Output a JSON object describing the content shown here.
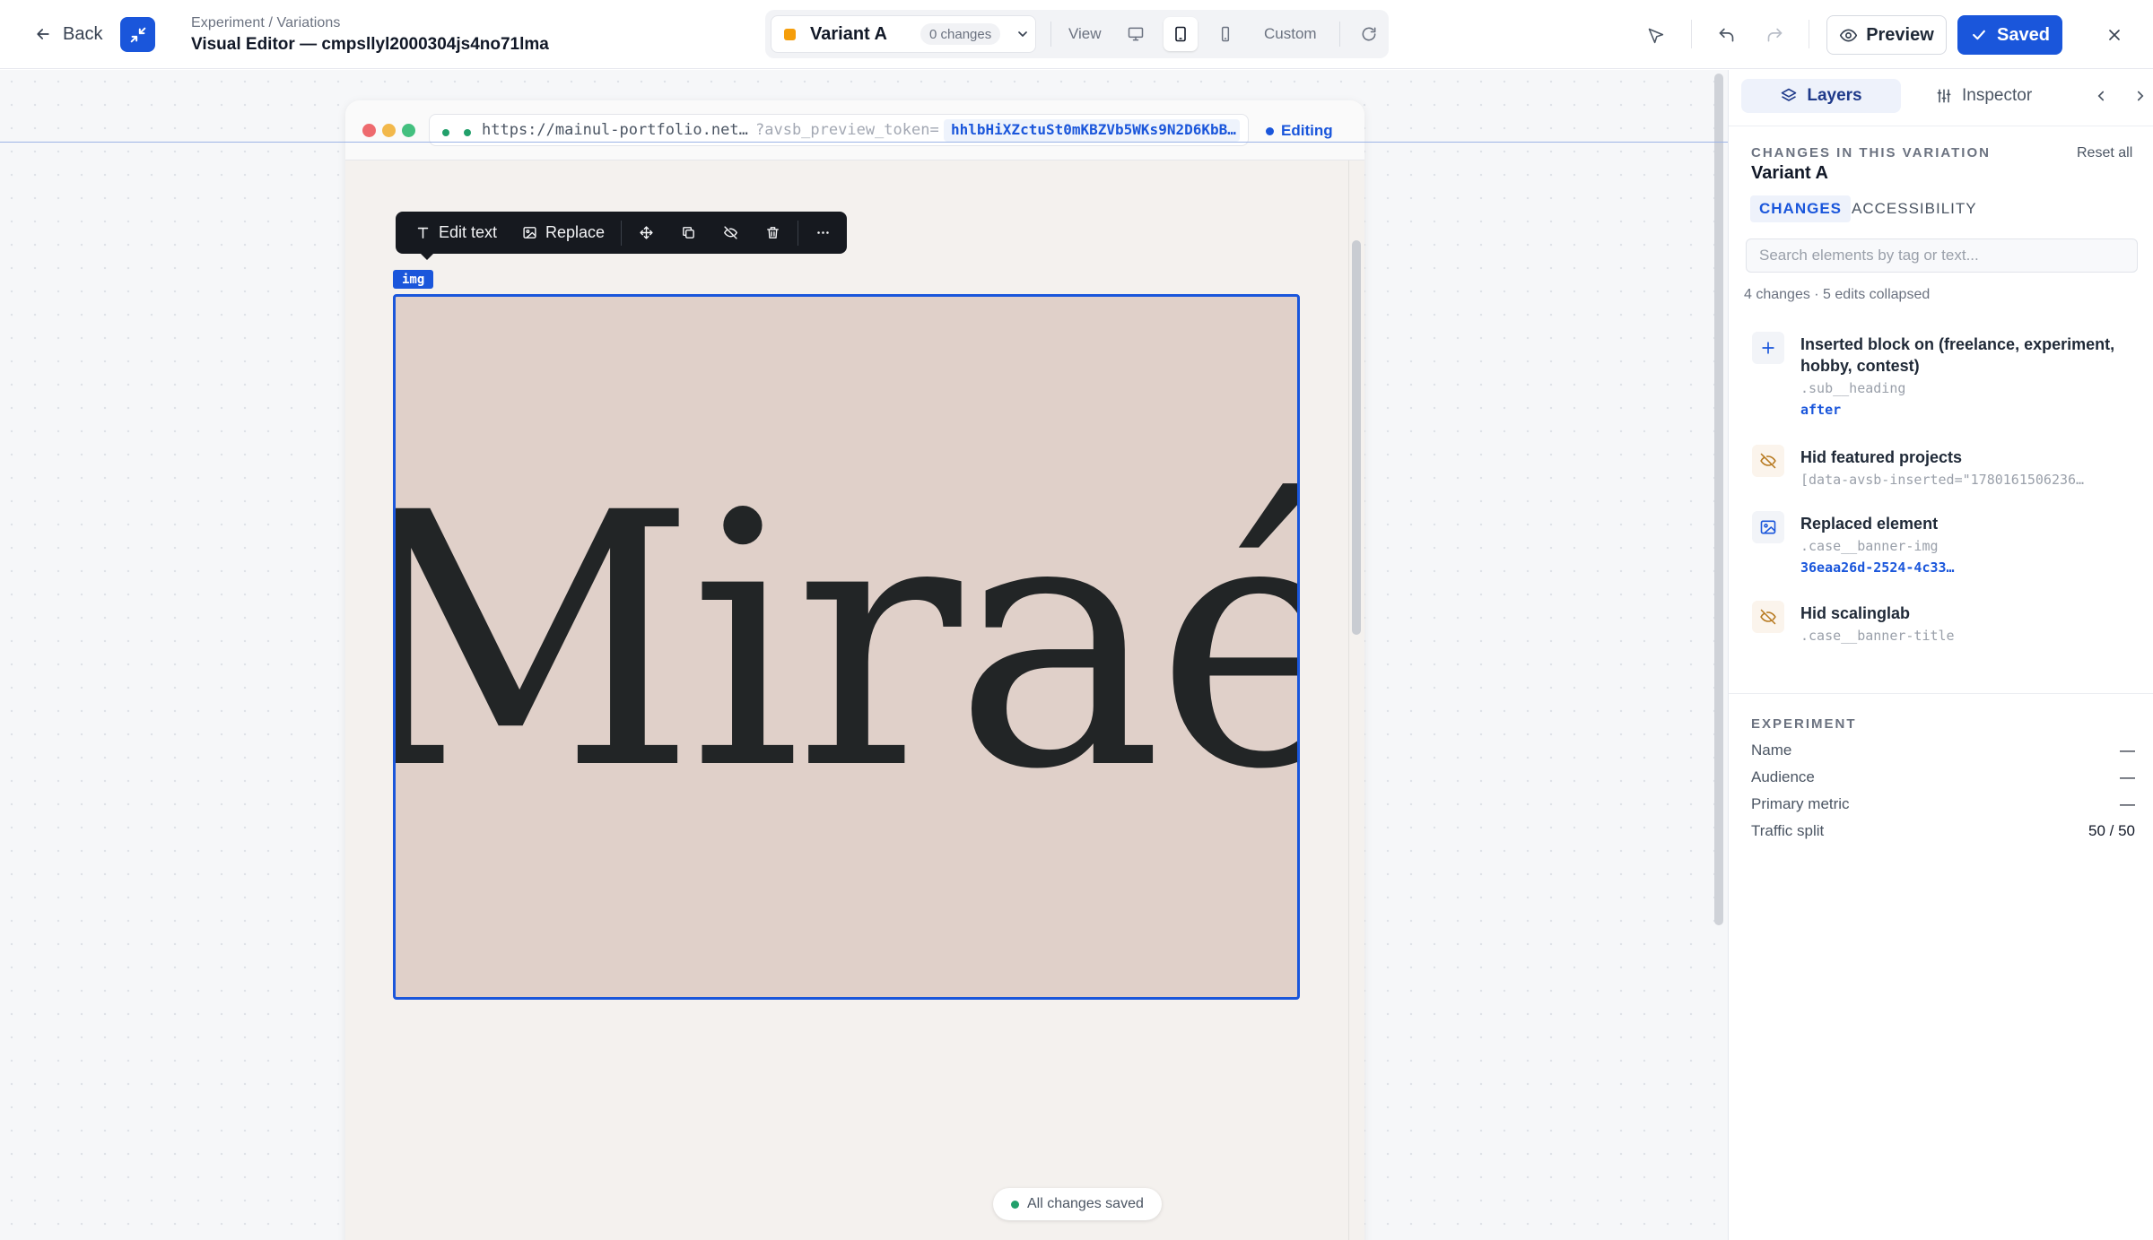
{
  "header": {
    "back_label": "Back",
    "breadcrumb": "Experiment / Variations",
    "title": "Visual Editor — cmpsllyl2000304js4no71lma",
    "variant": {
      "name": "Variant A",
      "changes": "0 changes",
      "color": "#f59e0b"
    },
    "view_label": "View",
    "custom_label": "Custom",
    "preview_label": "Preview",
    "saved_label": "Saved",
    "accent": "#1a56db"
  },
  "browser": {
    "url": "https://mainul-portfolio.net…",
    "url_param": "?avsb_preview_token=",
    "token": "hhlbHiXZctuSt0mKBZVb5WKs9N2D6KbB…",
    "editing_label": "Editing"
  },
  "toolbar": {
    "edit_text": "Edit text",
    "replace": "Replace",
    "tag": "img"
  },
  "canvas": {
    "image_text": "Miraé",
    "status": "All changes saved"
  },
  "panel": {
    "tabs": {
      "layers": "Layers",
      "inspector": "Inspector"
    },
    "changes_header": "CHANGES IN THIS VARIATION",
    "variant_name": "Variant A",
    "reset_all": "Reset all",
    "subtabs": {
      "changes": "CHANGES",
      "accessibility": "ACCESSIBILITY"
    },
    "search_placeholder": "Search elements by tag or text...",
    "summary": "4 changes · 5 edits collapsed",
    "changes": [
      {
        "icon": "plus-icon",
        "title": "Inserted block on (freelance, experiment, hobby, contest)",
        "selector": ".sub__heading",
        "meta": "after"
      },
      {
        "icon": "eye-off-icon",
        "title": "Hid featured projects",
        "selector": "[data-avsb-inserted=\"1780161506236…",
        "meta": ""
      },
      {
        "icon": "image-icon",
        "title": "Replaced element",
        "selector": ".case__banner-img",
        "meta": "36eaa26d-2524-4c33…"
      },
      {
        "icon": "eye-off-icon",
        "title": "Hid scalinglab",
        "selector": ".case__banner-title",
        "meta": ""
      }
    ],
    "experiment": {
      "header": "EXPERIMENT",
      "rows": [
        {
          "key": "Name",
          "value": "—"
        },
        {
          "key": "Audience",
          "value": "—"
        },
        {
          "key": "Primary metric",
          "value": "—"
        },
        {
          "key": "Traffic split",
          "value": "50 / 50"
        }
      ]
    }
  }
}
